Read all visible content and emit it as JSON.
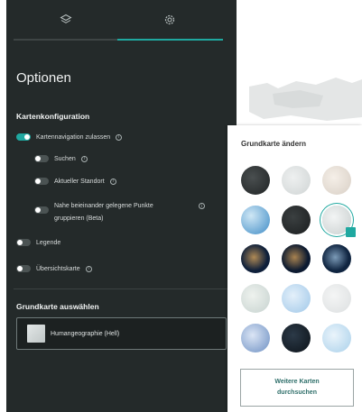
{
  "tabs": [
    {
      "icon": "layers-icon",
      "active": false
    },
    {
      "icon": "gear-icon",
      "active": true
    }
  ],
  "panel": {
    "title": "Optionen",
    "map_config_heading": "Kartenkonfiguration",
    "options": [
      {
        "label": "Kartennavigation zulassen",
        "on": true
      },
      {
        "label": "Suchen",
        "on": false
      },
      {
        "label": "Aktueller Standort",
        "on": false
      },
      {
        "label": "Nahe beieinander gelegene Punkte",
        "label2": "gruppieren (Beta)",
        "on": false
      },
      {
        "label": "Legende",
        "on": false
      },
      {
        "label": "Übersichtskarte",
        "on": false
      }
    ],
    "basemap_heading": "Grundkarte auswählen",
    "basemap_selected": "Humangeographie (Hell)"
  },
  "gallery": {
    "title": "Grundkarte ändern",
    "more_button_line1": "Weitere Karten",
    "more_button_line2": "durchsuchen",
    "selected_index": 5
  },
  "colors": {
    "panel_bg": "#242a2a",
    "accent": "#1fa8a0"
  }
}
